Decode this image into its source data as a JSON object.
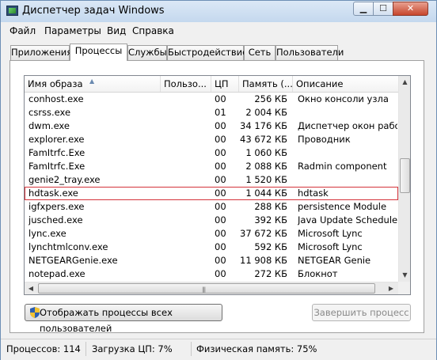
{
  "window": {
    "title": "Диспетчер задач Windows"
  },
  "caption_buttons": {
    "minimize": "▁",
    "maximize": "☐",
    "close": "✕"
  },
  "menu": [
    "Файл",
    "Параметры",
    "Вид",
    "Справка"
  ],
  "tabs": [
    "Приложения",
    "Процессы",
    "Службы",
    "Быстродействие",
    "Сеть",
    "Пользователи"
  ],
  "active_tab": "Процессы",
  "columns": [
    "Имя образа",
    "Пользо...",
    "ЦП",
    "Память (...",
    "Описание"
  ],
  "processes": [
    {
      "name": "conhost.exe",
      "user": "",
      "cpu": "00",
      "memory": "256 КБ",
      "description": "Окно консоли узла"
    },
    {
      "name": "csrss.exe",
      "user": "",
      "cpu": "01",
      "memory": "2 004 КБ",
      "description": ""
    },
    {
      "name": "dwm.exe",
      "user": "",
      "cpu": "00",
      "memory": "34 176 КБ",
      "description": "Диспетчер окон рабоче..."
    },
    {
      "name": "explorer.exe",
      "user": "",
      "cpu": "00",
      "memory": "43 672 КБ",
      "description": "Проводник"
    },
    {
      "name": "FamItrfc.Exe",
      "user": "",
      "cpu": "00",
      "memory": "1 060 КБ",
      "description": ""
    },
    {
      "name": "FamItrfc.Exe",
      "user": "",
      "cpu": "00",
      "memory": "2 088 КБ",
      "description": "Radmin component"
    },
    {
      "name": "genie2_tray.exe",
      "user": "",
      "cpu": "00",
      "memory": "1 520 КБ",
      "description": ""
    },
    {
      "name": "hdtask.exe",
      "user": "",
      "cpu": "00",
      "memory": "1 044 КБ",
      "description": "hdtask"
    },
    {
      "name": "igfxpers.exe",
      "user": "",
      "cpu": "00",
      "memory": "288 КБ",
      "description": "persistence Module"
    },
    {
      "name": "jusched.exe",
      "user": "",
      "cpu": "00",
      "memory": "392 КБ",
      "description": "Java Update Scheduler"
    },
    {
      "name": "lync.exe",
      "user": "",
      "cpu": "00",
      "memory": "37 672 КБ",
      "description": "Microsoft Lync"
    },
    {
      "name": "lynchtmlconv.exe",
      "user": "",
      "cpu": "00",
      "memory": "592 КБ",
      "description": "Microsoft Lync"
    },
    {
      "name": "NETGEARGenie.exe",
      "user": "",
      "cpu": "00",
      "memory": "11 908 КБ",
      "description": "NETGEAR Genie"
    },
    {
      "name": "notepad.exe",
      "user": "",
      "cpu": "00",
      "memory": "272 КБ",
      "description": "Блокнот"
    }
  ],
  "highlighted_row": "hdtask.exe",
  "buttons": {
    "show_all": "Отображать процессы всех пользователей",
    "end_process": "Завершить процесс"
  },
  "status": {
    "processes": "Процессов: 114",
    "cpu": "Загрузка ЦП: 7%",
    "memory": "Физическая память: 75%"
  }
}
